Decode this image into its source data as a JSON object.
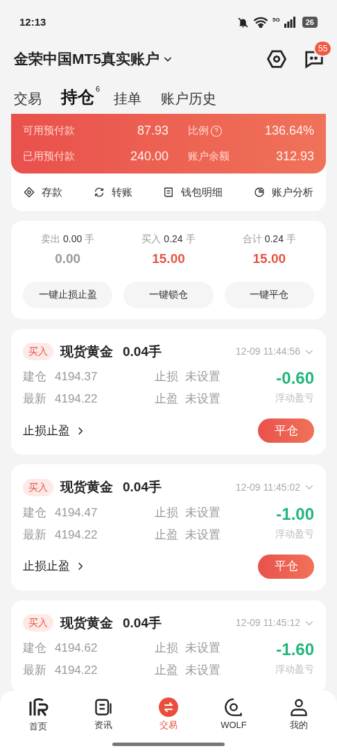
{
  "status_bar": {
    "time": "12:13",
    "network": "5G",
    "battery": "26"
  },
  "header": {
    "account": "金荣中国MT5真实账户",
    "notifications": "55"
  },
  "tabs": [
    {
      "label": "交易",
      "selected": false
    },
    {
      "label": "持仓",
      "selected": true,
      "badge": "6"
    },
    {
      "label": "挂单",
      "selected": false
    },
    {
      "label": "账户历史",
      "selected": false
    }
  ],
  "account_summary": {
    "rows": [
      [
        {
          "label": "可用预付款",
          "value": "87.93"
        },
        {
          "label": "比例",
          "value": "136.64%",
          "help": true
        }
      ],
      [
        {
          "label": "已用预付款",
          "value": "240.00"
        },
        {
          "label": "账户余额",
          "value": "312.93"
        }
      ]
    ],
    "actions": [
      {
        "kind": "deposit",
        "label": "存款"
      },
      {
        "kind": "transfer",
        "label": "转账"
      },
      {
        "kind": "wallet",
        "label": "钱包明细"
      },
      {
        "kind": "analysis",
        "label": "账户分析"
      }
    ]
  },
  "totals": {
    "columns": [
      {
        "label": "卖出",
        "lots": "0.00",
        "unit": "手",
        "value": "0.00",
        "active": false
      },
      {
        "label": "买入",
        "lots": "0.24",
        "unit": "手",
        "value": "15.00",
        "active": true
      },
      {
        "label": "合计",
        "lots": "0.24",
        "unit": "手",
        "value": "15.00",
        "active": true
      }
    ],
    "buttons": [
      "一键止损止盈",
      "一键锁仓",
      "一键平仓"
    ]
  },
  "positions": [
    {
      "side": "买入",
      "symbol": "现货黄金",
      "lots": "0.04手",
      "time": "12-09 11:44:56",
      "fields": [
        [
          "建仓",
          "4194.37"
        ],
        [
          "最新",
          "4194.22"
        ]
      ],
      "stops": [
        [
          "止损",
          "未设置"
        ],
        [
          "止盈",
          "未设置"
        ]
      ],
      "pnl": "-0.60",
      "pnl_label": "浮动盈亏",
      "footer": {
        "link": "止损止盈",
        "button": "平仓"
      }
    },
    {
      "side": "买入",
      "symbol": "现货黄金",
      "lots": "0.04手",
      "time": "12-09 11:45:02",
      "fields": [
        [
          "建仓",
          "4194.47"
        ],
        [
          "最新",
          "4194.22"
        ]
      ],
      "stops": [
        [
          "止损",
          "未设置"
        ],
        [
          "止盈",
          "未设置"
        ]
      ],
      "pnl": "-1.00",
      "pnl_label": "浮动盈亏",
      "footer": {
        "link": "止损止盈",
        "button": "平仓"
      }
    },
    {
      "side": "买入",
      "symbol": "现货黄金",
      "lots": "0.04手",
      "time": "12-09 11:45:12",
      "fields": [
        [
          "建仓",
          "4194.62"
        ],
        [
          "最新",
          "4194.22"
        ]
      ],
      "stops": [
        [
          "止损",
          "未设置"
        ],
        [
          "止盈",
          "未设置"
        ]
      ],
      "pnl": "-1.60",
      "pnl_label": "浮动盈亏"
    }
  ],
  "nav": [
    {
      "kind": "home",
      "label": "首页",
      "selected": false
    },
    {
      "kind": "news",
      "label": "资讯",
      "selected": false
    },
    {
      "kind": "trade",
      "label": "交易",
      "selected": true
    },
    {
      "kind": "wolf",
      "label": "WOLF",
      "selected": false
    },
    {
      "kind": "me",
      "label": "我的",
      "selected": false
    }
  ]
}
